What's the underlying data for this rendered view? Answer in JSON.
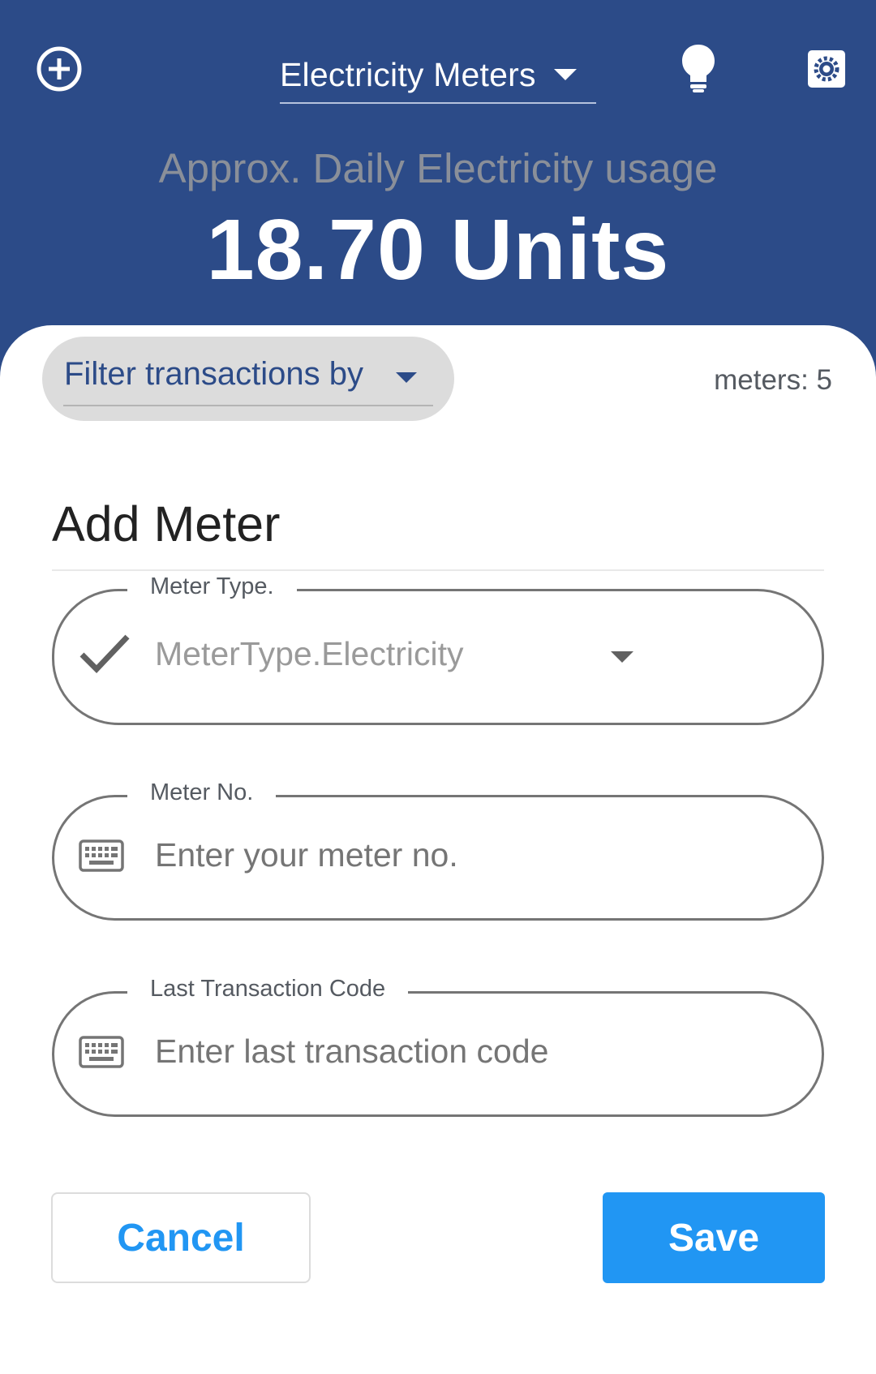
{
  "header": {
    "add_icon": "add-circle-icon",
    "meter_select_label": "Electricity Meters",
    "bulb_icon": "lightbulb-icon",
    "settings_icon": "settings-gear-icon",
    "usage_label": "Approx. Daily Electricity usage",
    "usage_value": "18.70 Units"
  },
  "filter": {
    "label": "Filter transactions by",
    "meters_count": "meters: 5"
  },
  "dialog": {
    "title": "Add Meter",
    "meter_type": {
      "label": "Meter Type.",
      "value": "MeterType.Electricity",
      "icon": "checkmark-icon"
    },
    "meter_no": {
      "label": "Meter No.",
      "placeholder": "Enter your meter no.",
      "icon": "keyboard-icon"
    },
    "last_transaction": {
      "label": "Last Transaction Code",
      "placeholder": "Enter last transaction code",
      "icon": "keyboard-icon"
    },
    "cancel_label": "Cancel",
    "save_label": "Save"
  },
  "colors": {
    "header_bg": "#2c4b88",
    "accent": "#2196f3",
    "chip_bg": "#dcdcdc"
  }
}
